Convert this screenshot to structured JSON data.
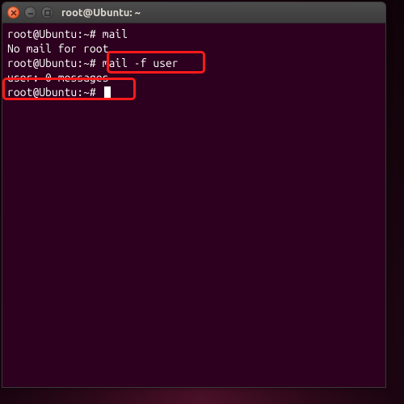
{
  "window": {
    "title": "root@Ubuntu: ~"
  },
  "terminal": {
    "lines": [
      "root@Ubuntu:~# mail",
      "No mail for root",
      "root@Ubuntu:~# mail -f user",
      "",
      "user: 0 messages",
      "root@Ubuntu:~# "
    ]
  },
  "highlights": [
    "mail -f user",
    "user: 0 messages"
  ]
}
